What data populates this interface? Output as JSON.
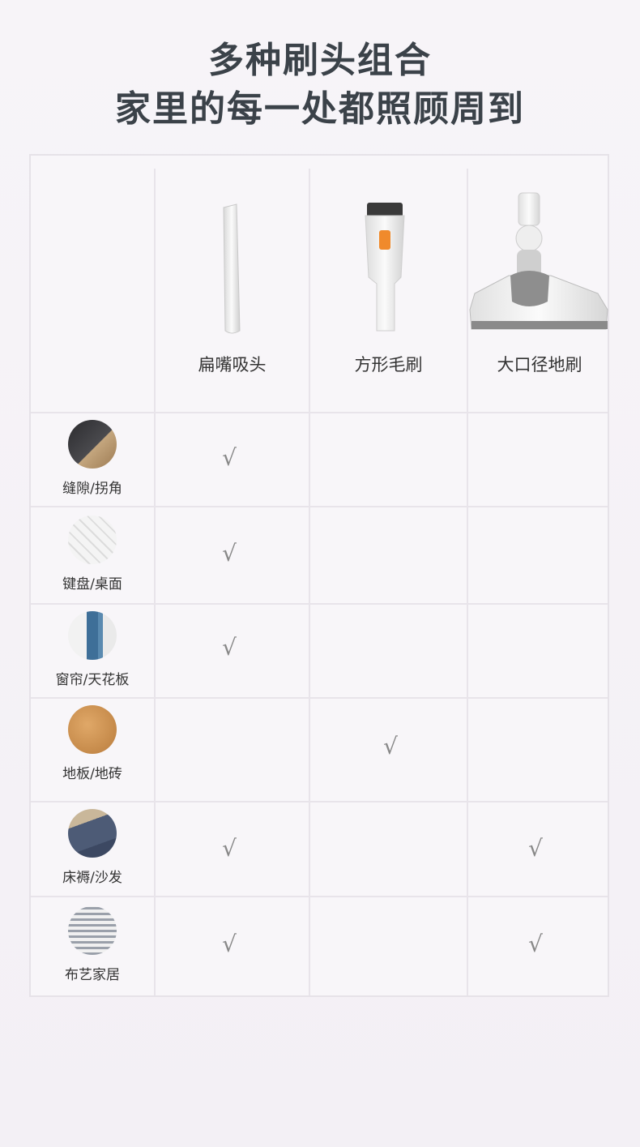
{
  "header": {
    "line1": "多种刷头组合",
    "line2": "家里的每一处都照顾周到"
  },
  "columns": [
    {
      "label": "扁嘴吸头",
      "icon": "crevice-nozzle-icon"
    },
    {
      "label": "方形毛刷",
      "icon": "square-brush-icon"
    },
    {
      "label": "大口径地刷",
      "icon": "floor-brush-icon"
    }
  ],
  "rows": [
    {
      "label": "缝隙/拐角",
      "icon": "corner-photo-icon",
      "checks": [
        true,
        false,
        false
      ]
    },
    {
      "label": "键盘/桌面",
      "icon": "keyboard-photo-icon",
      "checks": [
        true,
        false,
        false
      ]
    },
    {
      "label": "窗帘/天花板",
      "icon": "curtain-photo-icon",
      "checks": [
        true,
        false,
        false
      ]
    },
    {
      "label": "地板/地砖",
      "icon": "floor-photo-icon",
      "checks": [
        false,
        true,
        false
      ]
    },
    {
      "label": "床褥/沙发",
      "icon": "sofa-photo-icon",
      "checks": [
        true,
        false,
        true
      ]
    },
    {
      "label": "布艺家居",
      "icon": "fabric-photo-icon",
      "checks": [
        true,
        false,
        true
      ]
    }
  ],
  "check_mark": "√"
}
